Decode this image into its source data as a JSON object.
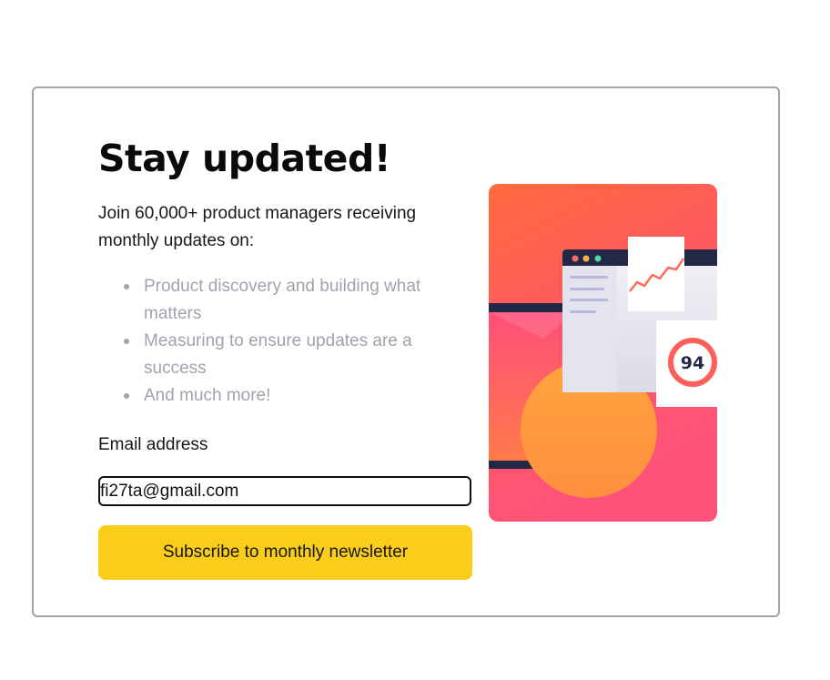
{
  "card": {
    "title": "Stay updated!",
    "intro": "Join 60,000+ product managers receiving monthly updates on:",
    "bullets": [
      "Product discovery and building what matters",
      "Measuring to ensure updates are a success",
      "And much more!"
    ],
    "email_label": "Email address",
    "email_value": "fi27ta@gmail.com",
    "subscribe_label": "Subscribe to monthly newsletter"
  },
  "illustration": {
    "score": "94"
  },
  "colors": {
    "accent": "#f9cd19",
    "gradient_top": "#ff6a3d",
    "gradient_bottom": "#ff527b",
    "muted_text": "#a0a3ad"
  }
}
